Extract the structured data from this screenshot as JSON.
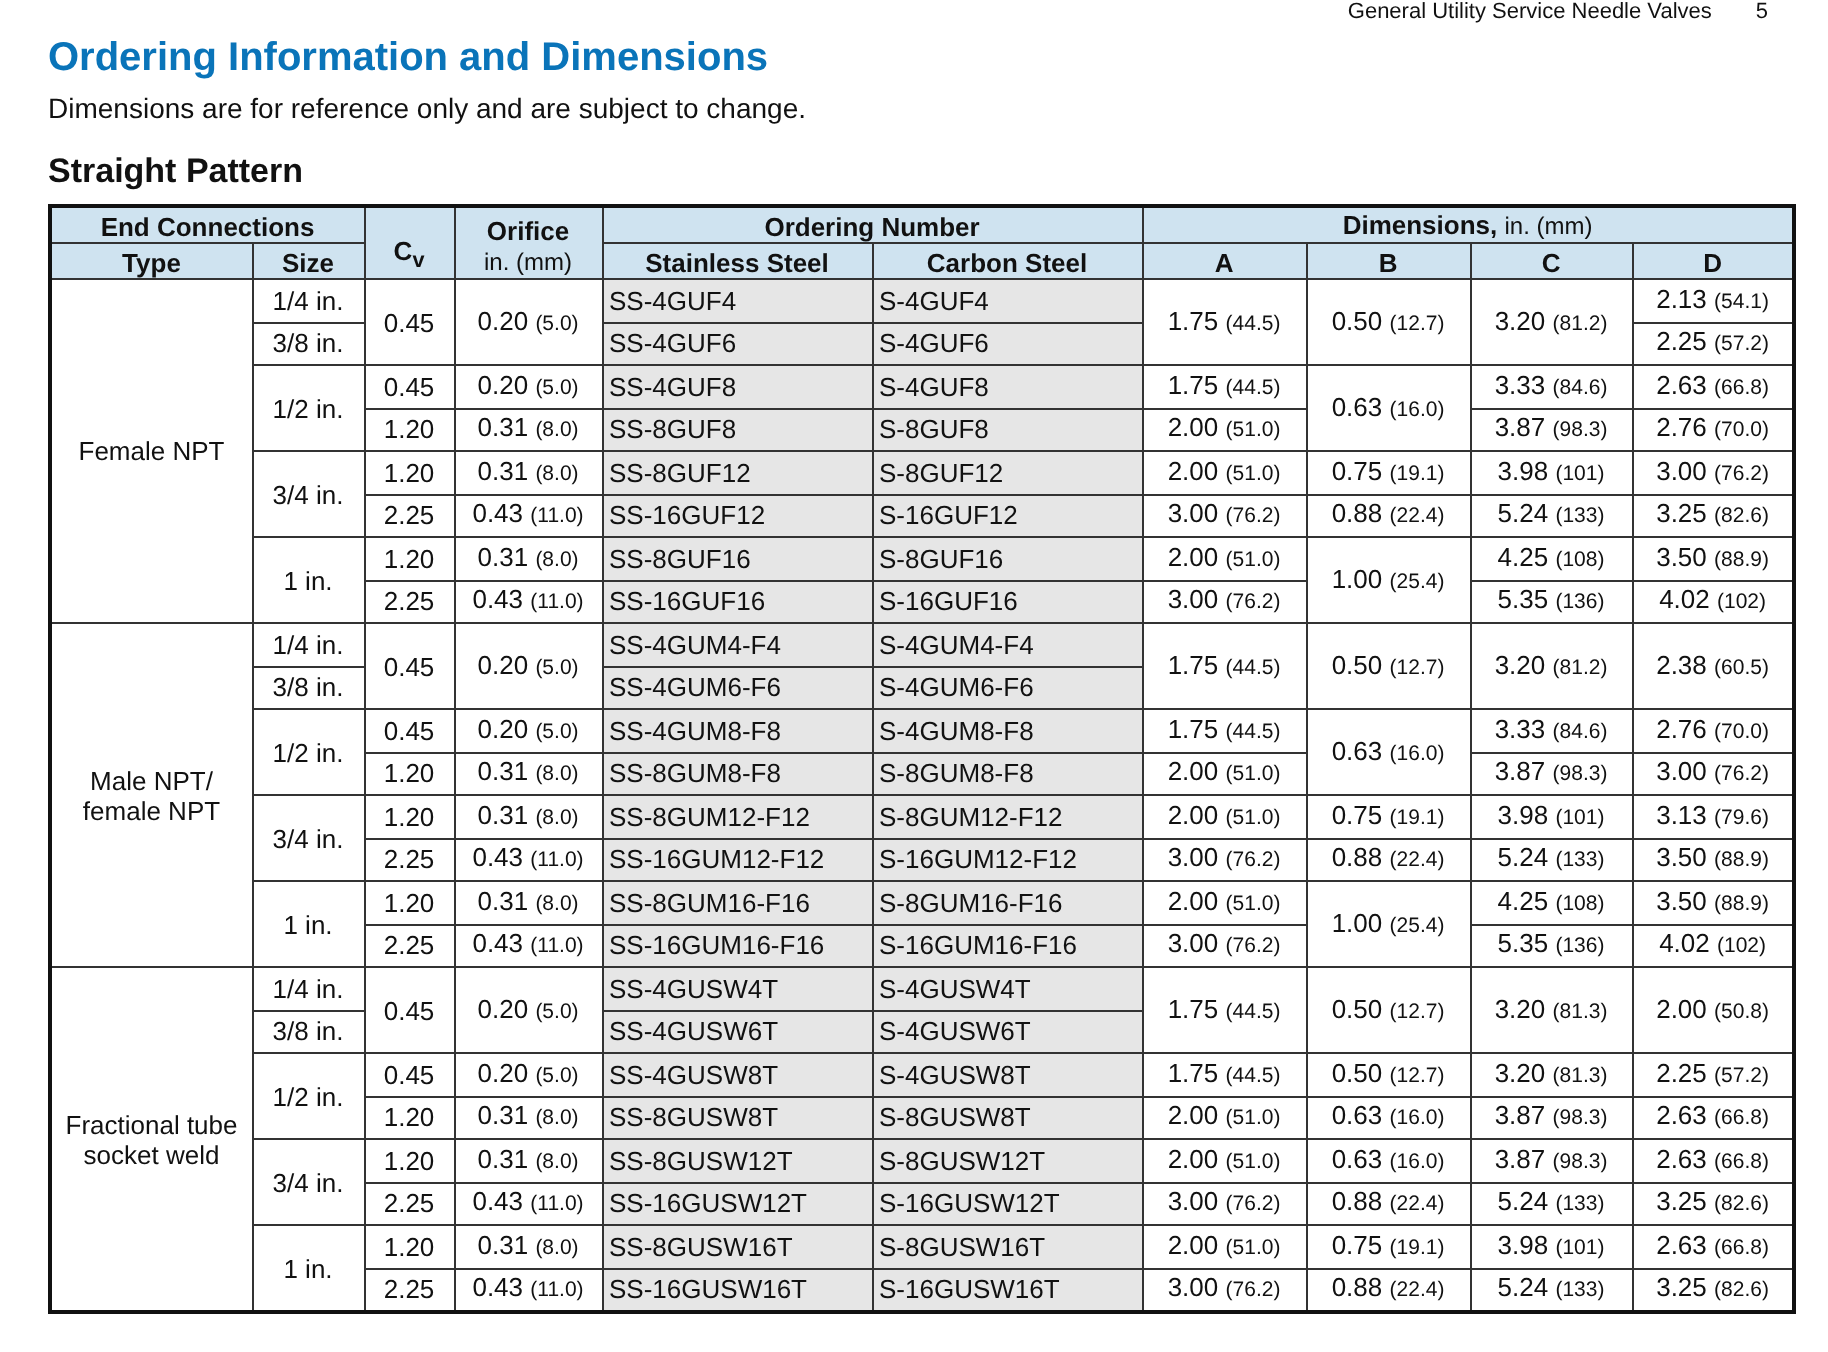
{
  "page_header": {
    "title": "General Utility Service Needle Valves",
    "page": "5"
  },
  "title": "Ordering Information and Dimensions",
  "note": "Dimensions are for reference only and are subject to change.",
  "section": "Straight Pattern",
  "table": {
    "header": [
      {
        "label": "End Connections",
        "columns": [
          "Type",
          "Size"
        ]
      },
      {
        "label": "C$_{v}$"
      },
      {
        "label": "Orifice",
        "unit": "in. (mm)"
      },
      {
        "label": "Ordering Number",
        "columns": [
          "Stainless Steel",
          "Carbon Steel"
        ]
      },
      {
        "label": "Dimensions,",
        "unit": "in. (mm)",
        "columns": [
          "A",
          "B",
          "C",
          "D"
        ]
      }
    ],
    "groups": [
      {
        "type": "Female NPT",
        "sizes": [
          {
            "size": "1/4 in.",
            "rows": [
              {
                "cv": "0.45",
                "orifice": {
                  "in": "0.20",
                  "mm": "(5.0)"
                },
                "ss": "SS-4GUF4",
                "cs": "S-4GUF4",
                "a": {
                  "in": "1.75",
                  "mm": "(44.5)"
                },
                "b": {
                  "in": "0.50",
                  "mm": "(12.7)"
                },
                "c": {
                  "in": "3.20",
                  "mm": "(81.2)"
                },
                "d": {
                  "in": "2.13",
                  "mm": "(54.1)"
                }
              }
            ]
          },
          {
            "size": "3/8 in.",
            "rows": [
              {
                "ss": "SS-4GUF6",
                "cs": "S-4GUF6",
                "d": {
                  "in": "2.25",
                  "mm": "(57.2)"
                }
              }
            ]
          },
          {
            "size": "1/2 in.",
            "rows": [
              {
                "cv": "0.45",
                "orifice": {
                  "in": "0.20",
                  "mm": "(5.0)"
                },
                "ss": "SS-4GUF8",
                "cs": "S-4GUF8",
                "a": {
                  "in": "1.75",
                  "mm": "(44.5)"
                },
                "b": {
                  "in": "0.63",
                  "mm": "(16.0)"
                },
                "c": {
                  "in": "3.33",
                  "mm": "(84.6)"
                },
                "d": {
                  "in": "2.63",
                  "mm": "(66.8)"
                }
              },
              {
                "cv": "1.20",
                "orifice": {
                  "in": "0.31",
                  "mm": "(8.0)"
                },
                "ss": "SS-8GUF8",
                "cs": "S-8GUF8",
                "a": {
                  "in": "2.00",
                  "mm": "(51.0)"
                },
                "c": {
                  "in": "3.87",
                  "mm": "(98.3)"
                },
                "d": {
                  "in": "2.76",
                  "mm": "(70.0)"
                }
              }
            ]
          },
          {
            "size": "3/4 in.",
            "rows": [
              {
                "cv": "1.20",
                "orifice": {
                  "in": "0.31",
                  "mm": "(8.0)"
                },
                "ss": "SS-8GUF12",
                "cs": "S-8GUF12",
                "a": {
                  "in": "2.00",
                  "mm": "(51.0)"
                },
                "b": {
                  "in": "0.75",
                  "mm": "(19.1)"
                },
                "c": {
                  "in": "3.98",
                  "mm": "(101)"
                },
                "d": {
                  "in": "3.00",
                  "mm": "(76.2)"
                }
              },
              {
                "cv": "2.25",
                "orifice": {
                  "in": "0.43",
                  "mm": "(11.0)"
                },
                "ss": "SS-16GUF12",
                "cs": "S-16GUF12",
                "a": {
                  "in": "3.00",
                  "mm": "(76.2)"
                },
                "b": {
                  "in": "0.88",
                  "mm": "(22.4)"
                },
                "c": {
                  "in": "5.24",
                  "mm": "(133)"
                },
                "d": {
                  "in": "3.25",
                  "mm": "(82.6)"
                }
              }
            ]
          },
          {
            "size": "1 in.",
            "rows": [
              {
                "cv": "1.20",
                "orifice": {
                  "in": "0.31",
                  "mm": "(8.0)"
                },
                "ss": "SS-8GUF16",
                "cs": "S-8GUF16",
                "a": {
                  "in": "2.00",
                  "mm": "(51.0)"
                },
                "b": {
                  "in": "1.00",
                  "mm": "(25.4)"
                },
                "c": {
                  "in": "4.25",
                  "mm": "(108)"
                },
                "d": {
                  "in": "3.50",
                  "mm": "(88.9)"
                }
              },
              {
                "cv": "2.25",
                "orifice": {
                  "in": "0.43",
                  "mm": "(11.0)"
                },
                "ss": "SS-16GUF16",
                "cs": "S-16GUF16",
                "a": {
                  "in": "3.00",
                  "mm": "(76.2)"
                },
                "c": {
                  "in": "5.35",
                  "mm": "(136)"
                },
                "d": {
                  "in": "4.02",
                  "mm": "(102)"
                }
              }
            ]
          }
        ]
      },
      {
        "type": "Male NPT/\nfemale NPT",
        "sizes": [
          {
            "size": "1/4 in.",
            "rows": [
              {
                "cv": "0.45",
                "orifice": {
                  "in": "0.20",
                  "mm": "(5.0)"
                },
                "ss": "SS-4GUM4-F4",
                "cs": "S-4GUM4-F4",
                "a": {
                  "in": "1.75",
                  "mm": "(44.5)"
                },
                "b": {
                  "in": "0.50",
                  "mm": "(12.7)"
                },
                "c": {
                  "in": "3.20",
                  "mm": "(81.2)"
                },
                "d": {
                  "in": "2.38",
                  "mm": "(60.5)"
                }
              }
            ]
          },
          {
            "size": "3/8 in.",
            "rows": [
              {
                "ss": "SS-4GUM6-F6",
                "cs": "S-4GUM6-F6"
              }
            ]
          },
          {
            "size": "1/2 in.",
            "rows": [
              {
                "cv": "0.45",
                "orifice": {
                  "in": "0.20",
                  "mm": "(5.0)"
                },
                "ss": "SS-4GUM8-F8",
                "cs": "S-4GUM8-F8",
                "a": {
                  "in": "1.75",
                  "mm": "(44.5)"
                },
                "b": {
                  "in": "0.63",
                  "mm": "(16.0)"
                },
                "c": {
                  "in": "3.33",
                  "mm": "(84.6)"
                },
                "d": {
                  "in": "2.76",
                  "mm": "(70.0)"
                }
              },
              {
                "cv": "1.20",
                "orifice": {
                  "in": "0.31",
                  "mm": "(8.0)"
                },
                "ss": "SS-8GUM8-F8",
                "cs": "S-8GUM8-F8",
                "a": {
                  "in": "2.00",
                  "mm": "(51.0)"
                },
                "c": {
                  "in": "3.87",
                  "mm": "(98.3)"
                },
                "d": {
                  "in": "3.00",
                  "mm": "(76.2)"
                }
              }
            ]
          },
          {
            "size": "3/4 in.",
            "rows": [
              {
                "cv": "1.20",
                "orifice": {
                  "in": "0.31",
                  "mm": "(8.0)"
                },
                "ss": "SS-8GUM12-F12",
                "cs": "S-8GUM12-F12",
                "a": {
                  "in": "2.00",
                  "mm": "(51.0)"
                },
                "b": {
                  "in": "0.75",
                  "mm": "(19.1)"
                },
                "c": {
                  "in": "3.98",
                  "mm": "(101)"
                },
                "d": {
                  "in": "3.13",
                  "mm": "(79.6)"
                }
              },
              {
                "cv": "2.25",
                "orifice": {
                  "in": "0.43",
                  "mm": "(11.0)"
                },
                "ss": "SS-16GUM12-F12",
                "cs": "S-16GUM12-F12",
                "a": {
                  "in": "3.00",
                  "mm": "(76.2)"
                },
                "b": {
                  "in": "0.88",
                  "mm": "(22.4)"
                },
                "c": {
                  "in": "5.24",
                  "mm": "(133)"
                },
                "d": {
                  "in": "3.50",
                  "mm": "(88.9)"
                }
              }
            ]
          },
          {
            "size": "1 in.",
            "rows": [
              {
                "cv": "1.20",
                "orifice": {
                  "in": "0.31",
                  "mm": "(8.0)"
                },
                "ss": "SS-8GUM16-F16",
                "cs": "S-8GUM16-F16",
                "a": {
                  "in": "2.00",
                  "mm": "(51.0)"
                },
                "b": {
                  "in": "1.00",
                  "mm": "(25.4)"
                },
                "c": {
                  "in": "4.25",
                  "mm": "(108)"
                },
                "d": {
                  "in": "3.50",
                  "mm": "(88.9)"
                }
              },
              {
                "cv": "2.25",
                "orifice": {
                  "in": "0.43",
                  "mm": "(11.0)"
                },
                "ss": "SS-16GUM16-F16",
                "cs": "S-16GUM16-F16",
                "a": {
                  "in": "3.00",
                  "mm": "(76.2)"
                },
                "c": {
                  "in": "5.35",
                  "mm": "(136)"
                },
                "d": {
                  "in": "4.02",
                  "mm": "(102)"
                }
              }
            ]
          }
        ]
      },
      {
        "type": "Fractional tube\nsocket weld",
        "sizes": [
          {
            "size": "1/4 in.",
            "rows": [
              {
                "cv": "0.45",
                "orifice": {
                  "in": "0.20",
                  "mm": "(5.0)"
                },
                "ss": "SS-4GUSW4T",
                "cs": "S-4GUSW4T",
                "a": {
                  "in": "1.75",
                  "mm": "(44.5)"
                },
                "b": {
                  "in": "0.50",
                  "mm": "(12.7)"
                },
                "c": {
                  "in": "3.20",
                  "mm": "(81.3)"
                },
                "d": {
                  "in": "2.00",
                  "mm": "(50.8)"
                }
              }
            ]
          },
          {
            "size": "3/8 in.",
            "rows": [
              {
                "ss": "SS-4GUSW6T",
                "cs": "S-4GUSW6T"
              }
            ]
          },
          {
            "size": "1/2 in.",
            "rows": [
              {
                "cv": "0.45",
                "orifice": {
                  "in": "0.20",
                  "mm": "(5.0)"
                },
                "ss": "SS-4GUSW8T",
                "cs": "S-4GUSW8T",
                "a": {
                  "in": "1.75",
                  "mm": "(44.5)"
                },
                "b": {
                  "in": "0.50",
                  "mm": "(12.7)"
                },
                "c": {
                  "in": "3.20",
                  "mm": "(81.3)"
                },
                "d": {
                  "in": "2.25",
                  "mm": "(57.2)"
                }
              },
              {
                "cv": "1.20",
                "orifice": {
                  "in": "0.31",
                  "mm": "(8.0)"
                },
                "ss": "SS-8GUSW8T",
                "cs": "S-8GUSW8T",
                "a": {
                  "in": "2.00",
                  "mm": "(51.0)"
                },
                "b": {
                  "in": "0.63",
                  "mm": "(16.0)"
                },
                "c": {
                  "in": "3.87",
                  "mm": "(98.3)"
                },
                "d": {
                  "in": "2.63",
                  "mm": "(66.8)"
                }
              }
            ]
          },
          {
            "size": "3/4 in.",
            "rows": [
              {
                "cv": "1.20",
                "orifice": {
                  "in": "0.31",
                  "mm": "(8.0)"
                },
                "ss": "SS-8GUSW12T",
                "cs": "S-8GUSW12T",
                "a": {
                  "in": "2.00",
                  "mm": "(51.0)"
                },
                "b": {
                  "in": "0.63",
                  "mm": "(16.0)"
                },
                "c": {
                  "in": "3.87",
                  "mm": "(98.3)"
                },
                "d": {
                  "in": "2.63",
                  "mm": "(66.8)"
                }
              },
              {
                "cv": "2.25",
                "orifice": {
                  "in": "0.43",
                  "mm": "(11.0)"
                },
                "ss": "SS-16GUSW12T",
                "cs": "S-16GUSW12T",
                "a": {
                  "in": "3.00",
                  "mm": "(76.2)"
                },
                "b": {
                  "in": "0.88",
                  "mm": "(22.4)"
                },
                "c": {
                  "in": "5.24",
                  "mm": "(133)"
                },
                "d": {
                  "in": "3.25",
                  "mm": "(82.6)"
                }
              }
            ]
          },
          {
            "size": "1 in.",
            "rows": [
              {
                "cv": "1.20",
                "orifice": {
                  "in": "0.31",
                  "mm": "(8.0)"
                },
                "ss": "SS-8GUSW16T",
                "cs": "S-8GUSW16T",
                "a": {
                  "in": "2.00",
                  "mm": "(51.0)"
                },
                "b": {
                  "in": "0.75",
                  "mm": "(19.1)"
                },
                "c": {
                  "in": "3.98",
                  "mm": "(101)"
                },
                "d": {
                  "in": "2.63",
                  "mm": "(66.8)"
                }
              },
              {
                "cv": "2.25",
                "orifice": {
                  "in": "0.43",
                  "mm": "(11.0)"
                },
                "ss": "SS-16GUSW16T",
                "cs": "S-16GUSW16T",
                "a": {
                  "in": "3.00",
                  "mm": "(76.2)"
                },
                "b": {
                  "in": "0.88",
                  "mm": "(22.4)"
                },
                "c": {
                  "in": "5.24",
                  "mm": "(133)"
                },
                "d": {
                  "in": "3.25",
                  "mm": "(82.6)"
                }
              }
            ]
          }
        ]
      }
    ]
  }
}
